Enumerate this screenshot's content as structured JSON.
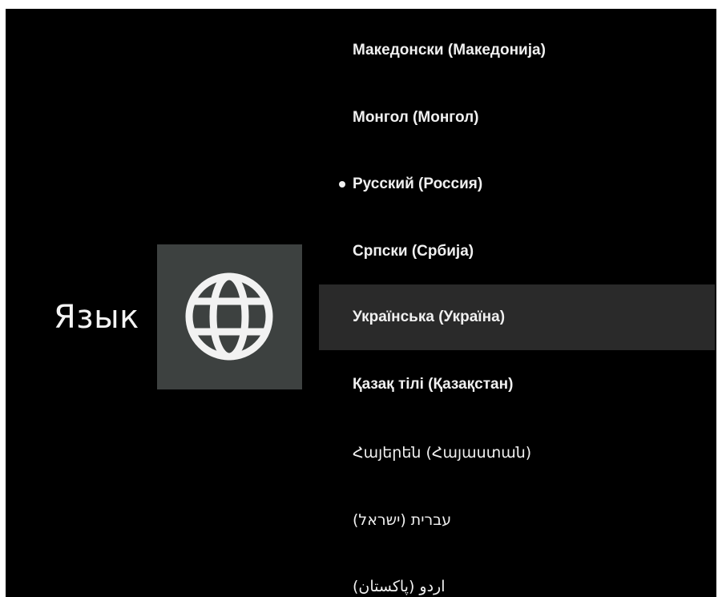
{
  "page": {
    "title": "Язык",
    "icon": "globe-icon"
  },
  "languages": [
    {
      "label": "Македонски (Македонија)",
      "current": false,
      "focused": false
    },
    {
      "label": "Монгол (Монгол)",
      "current": false,
      "focused": false
    },
    {
      "label": "Русский (Россия)",
      "current": true,
      "focused": false
    },
    {
      "label": "Српски (Србија)",
      "current": false,
      "focused": false
    },
    {
      "label": "Українська (Україна)",
      "current": false,
      "focused": true
    },
    {
      "label": "Қазақ тілі (Қазақстан)",
      "current": false,
      "focused": false
    },
    {
      "label": "Հայերեն (Հայաստան)",
      "current": false,
      "focused": false
    },
    {
      "label": "עברית (ישראל)",
      "current": false,
      "focused": false
    },
    {
      "label": "اردو (پاکستان)",
      "current": false,
      "focused": false
    }
  ],
  "colors": {
    "background": "#000000",
    "icon_tile": "#3d4140",
    "focused_row": "#2a2a2a",
    "text": "#f0f0f0"
  }
}
